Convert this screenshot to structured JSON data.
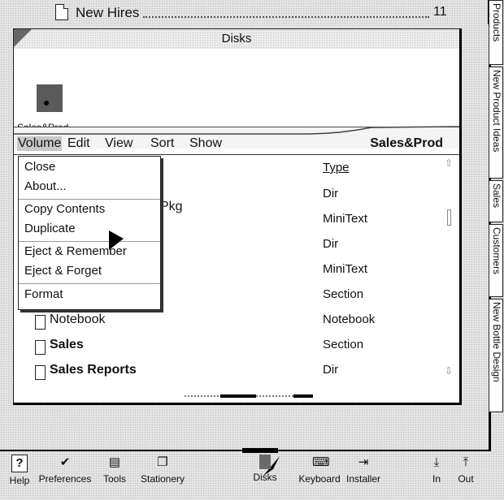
{
  "top_item": {
    "label": "New Hires",
    "count": "11"
  },
  "window": {
    "title": "Disks",
    "disk_label": "Sales&Prod",
    "name": "Sales&Prod",
    "menus": [
      "Volume",
      "Edit",
      "View",
      "Sort",
      "Show"
    ],
    "type_header": "Type",
    "partial_name": "Pkg",
    "rows": [
      {
        "name": "",
        "type": "Dir"
      },
      {
        "name": "",
        "type": "MiniText"
      },
      {
        "name": "",
        "type": "Dir"
      },
      {
        "name": "",
        "type": "MiniText"
      },
      {
        "name": "",
        "type": "Section"
      },
      {
        "name": "Notebook",
        "type": "Notebook"
      },
      {
        "name": "Sales",
        "type": "Section"
      },
      {
        "name": "Sales Reports",
        "type": "Dir"
      }
    ]
  },
  "volume_menu": [
    "Close",
    "About...",
    "Copy Contents",
    "Duplicate",
    "Eject & Remember",
    "Eject & Forget",
    "Format"
  ],
  "tabs": [
    "Products",
    "New Product Ideas",
    "Sales",
    "Customers",
    "New Bottle Design"
  ],
  "dock": [
    "Help",
    "Preferences",
    "Tools",
    "Stationery",
    "Disks",
    "Keyboard",
    "Installer",
    "In",
    "Out"
  ]
}
